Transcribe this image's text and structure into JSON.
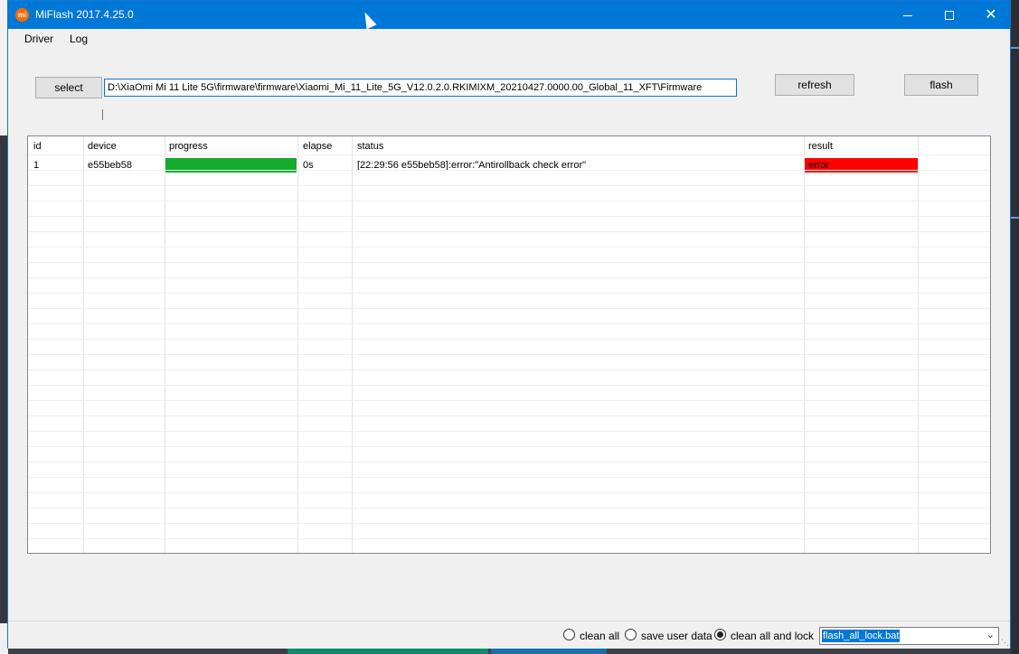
{
  "window": {
    "title": "MiFlash 2017.4.25.0",
    "app_icon_text": "mi",
    "minimize_glyph": "",
    "close_glyph": "✕"
  },
  "menu": {
    "driver": "Driver",
    "log": "Log"
  },
  "toolbar": {
    "select_label": "select",
    "path_value": "D:\\XiaOmi Mi 11 Lite 5G\\firmware\\firmware\\Xiaomi_Mi_11_Lite_5G_V12.0.2.0.RKIMIXM_20210427.0000.00_Global_11_XFT\\Firmware",
    "refresh_label": "refresh",
    "flash_label": "flash"
  },
  "grid": {
    "headers": {
      "id": "id",
      "device": "device",
      "progress": "progress",
      "elapse": "elapse",
      "status": "status",
      "result": "result"
    },
    "rows": [
      {
        "id": "1",
        "device": "e55beb58",
        "progress": 1.0,
        "elapse": "0s",
        "status": "[22:29:56  e55beb58]:error:\"Antirollback check error\"",
        "result": "error"
      }
    ]
  },
  "status_bar": {
    "options": [
      {
        "label": "clean all",
        "selected": false
      },
      {
        "label": "save user data",
        "selected": false
      },
      {
        "label": "clean all and lock",
        "selected": true
      }
    ],
    "script_select": "flash_all_lock.bat"
  },
  "colors": {
    "titlebar": "#0078d7",
    "progress_fill": "#14ab2f",
    "result_error": "#ff0000"
  },
  "icons": [
    "mi-logo-icon",
    "minimize-icon",
    "maximize-icon",
    "close-icon",
    "dropdown-arrow-icon",
    "mouse-cursor-icon"
  ]
}
